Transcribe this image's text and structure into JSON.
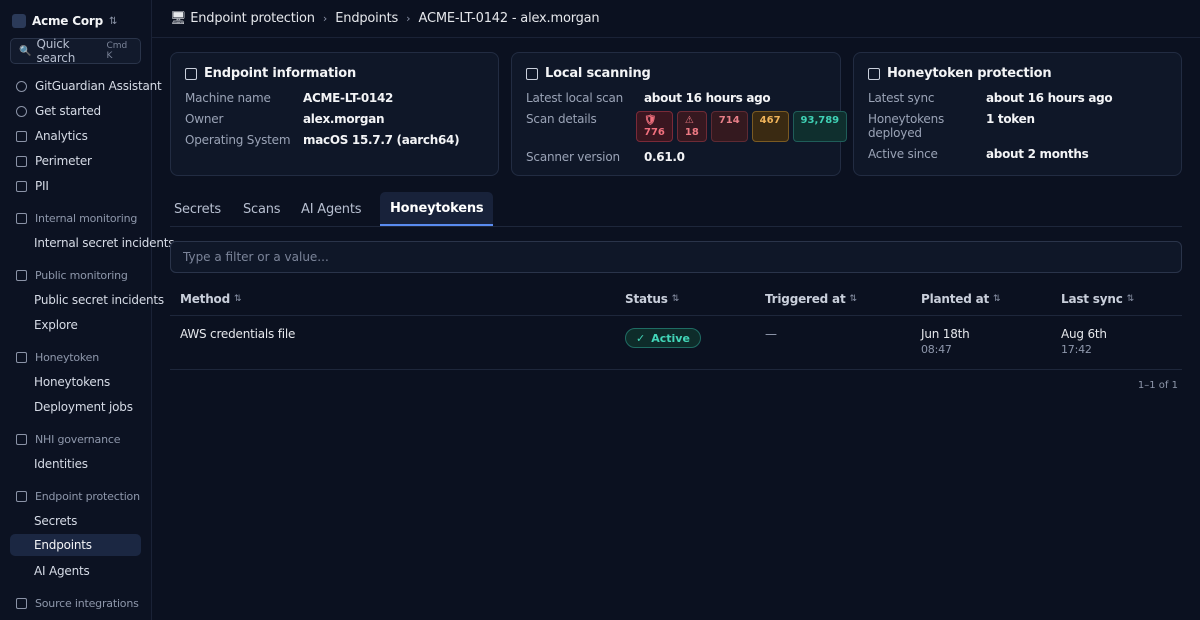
{
  "org": {
    "name": "Acme Corp",
    "swap_icon": "⇅"
  },
  "search": {
    "label": "Quick search",
    "shortcut": "Cmd K"
  },
  "sidebar": {
    "items": [
      {
        "label": "GitGuardian Assistant",
        "icon": "assistant-icon"
      },
      {
        "label": "Get started",
        "icon": "rocket-icon"
      },
      {
        "label": "Analytics",
        "icon": "chart-icon"
      },
      {
        "label": "Perimeter",
        "icon": "perimeter-icon"
      },
      {
        "label": "PII",
        "icon": "pii-icon"
      },
      {
        "label": "Internal monitoring",
        "icon": "monitor-icon"
      },
      {
        "label": "Internal secret incidents"
      },
      {
        "label": "Public monitoring",
        "icon": "globe-icon"
      },
      {
        "label": "Public secret incidents"
      },
      {
        "label": "Explore"
      },
      {
        "label": "Honeytoken",
        "icon": "honeytoken-icon"
      },
      {
        "label": "Honeytokens"
      },
      {
        "label": "Deployment jobs"
      },
      {
        "label": "NHI governance",
        "icon": "key-icon"
      },
      {
        "label": "Identities"
      },
      {
        "label": "Endpoint protection",
        "icon": "laptop-icon"
      },
      {
        "label": "Secrets"
      },
      {
        "label": "Endpoints"
      },
      {
        "label": "AI Agents"
      },
      {
        "label": "Source integrations",
        "icon": "plug-icon"
      }
    ]
  },
  "breadcrumb": {
    "icon": "🖥",
    "items": [
      "Endpoint protection",
      "Endpoints",
      "ACME-LT-0142 - alex.morgan"
    ],
    "separator": "›"
  },
  "cards": {
    "endpoint": {
      "title": "Endpoint information",
      "rows": [
        {
          "label": "Machine name",
          "value": "ACME-LT-0142"
        },
        {
          "label": "Owner",
          "value": "alex.morgan"
        },
        {
          "label": "Operating System",
          "value": "macOS 15.7.7 (aarch64)"
        }
      ]
    },
    "scanning": {
      "title": "Local scanning",
      "latest_label": "Latest local scan",
      "latest_value": "about 16 hours ago",
      "details_label": "Scan details",
      "badges": [
        {
          "icon": "🛡",
          "value": "776"
        },
        {
          "icon": "⚠",
          "value": "18"
        },
        {
          "value": "714"
        },
        {
          "value": "467"
        },
        {
          "value": "93,789"
        }
      ],
      "version_label": "Scanner version",
      "version_value": "0.61.0"
    },
    "honeytoken": {
      "title": "Honeytoken protection",
      "rows": [
        {
          "label": "Latest sync",
          "value": "about 16 hours ago"
        },
        {
          "label": "Honeytokens deployed",
          "value": "1 token"
        },
        {
          "label": "Active since",
          "value": "about 2 months"
        }
      ]
    }
  },
  "tabs": [
    "Secrets",
    "Scans",
    "AI Agents",
    "Honeytokens"
  ],
  "filter": {
    "placeholder": "Type a filter or a value..."
  },
  "table": {
    "sort_icon": "⇅",
    "headers": [
      "Method",
      "Status",
      "Triggered at",
      "Planted at",
      "Last sync"
    ],
    "rows": [
      {
        "method": "AWS credentials file",
        "status": "Active",
        "status_icon": "✓",
        "triggered": "—",
        "planted_date": "Jun 18th",
        "planted_time": "08:47",
        "sync_date": "Aug 6th",
        "sync_time": "17:42"
      }
    ]
  },
  "pagination": "1–1 of 1"
}
